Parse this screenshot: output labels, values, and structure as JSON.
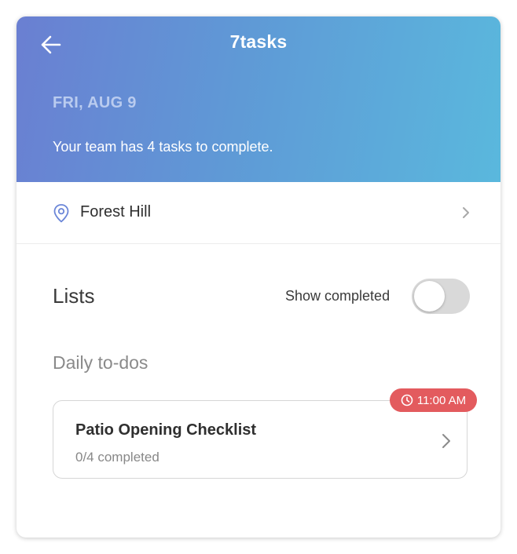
{
  "header": {
    "title": "7tasks",
    "back_icon": "arrow-left-icon",
    "date": "FRI, AUG 9",
    "summary": "Your team has 4 tasks to complete."
  },
  "location": {
    "icon": "map-pin-icon",
    "name": "Forest Hill",
    "chevron_icon": "chevron-right-icon"
  },
  "lists": {
    "title": "Lists",
    "show_completed_label": "Show completed",
    "show_completed_on": false
  },
  "sections": [
    {
      "heading": "Daily to-dos",
      "tasks": [
        {
          "title": "Patio Opening Checklist",
          "progress": "0/4 completed",
          "due_time": "11:00 AM",
          "due_icon": "clock-icon"
        }
      ]
    }
  ],
  "colors": {
    "gradient_start": "#6a7fd2",
    "gradient_end": "#5ab8dd",
    "badge": "#e35b5e",
    "toggle_off": "#d9d9d9"
  }
}
